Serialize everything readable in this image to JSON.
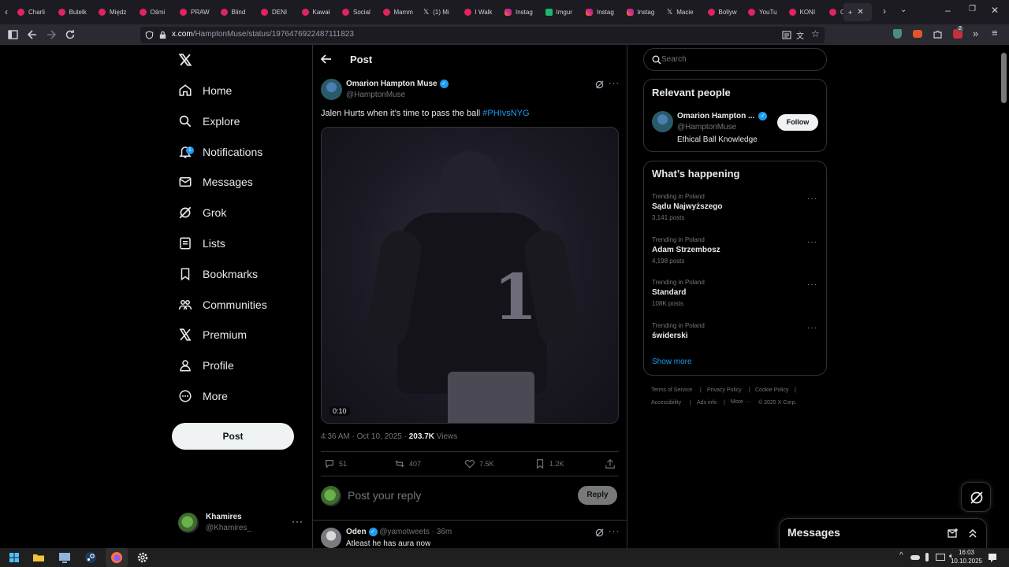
{
  "browser": {
    "tabs": [
      {
        "label": "Charli",
        "icon": "yt"
      },
      {
        "label": "Butelk",
        "icon": "yt"
      },
      {
        "label": "Międz",
        "icon": "yt"
      },
      {
        "label": "Ośmi",
        "icon": "yt"
      },
      {
        "label": "PRAW",
        "icon": "yt"
      },
      {
        "label": "Blind",
        "icon": "yt"
      },
      {
        "label": "DENI",
        "icon": "yt"
      },
      {
        "label": "Kawał",
        "icon": "yt"
      },
      {
        "label": "Social",
        "icon": "yt"
      },
      {
        "label": "Mamm",
        "icon": "yt"
      },
      {
        "label": "(1) Mi",
        "icon": "x"
      },
      {
        "label": "I Walk",
        "icon": "yt"
      },
      {
        "label": "Instag",
        "icon": "ig"
      },
      {
        "label": "Imgur",
        "icon": "im"
      },
      {
        "label": "Instag",
        "icon": "ig"
      },
      {
        "label": "Instag",
        "icon": "ig"
      },
      {
        "label": "Macie",
        "icon": "x"
      },
      {
        "label": "Bollyw",
        "icon": "yt"
      },
      {
        "label": "YouTu",
        "icon": "yt"
      },
      {
        "label": "KONI",
        "icon": "yt"
      },
      {
        "label": "Odeb",
        "icon": "yt"
      }
    ],
    "url_host": "x.com",
    "url_path": "/HamptonMuse/status/1976476922487111823",
    "notif_count": "2"
  },
  "nav": {
    "items": [
      {
        "label": "Home",
        "icon": "home-icon"
      },
      {
        "label": "Explore",
        "icon": "search-icon"
      },
      {
        "label": "Notifications",
        "icon": "bell-icon"
      },
      {
        "label": "Messages",
        "icon": "mail-icon"
      },
      {
        "label": "Grok",
        "icon": "grok-icon"
      },
      {
        "label": "Lists",
        "icon": "list-icon"
      },
      {
        "label": "Bookmarks",
        "icon": "bookmark-icon"
      },
      {
        "label": "Communities",
        "icon": "communities-icon"
      },
      {
        "label": "Premium",
        "icon": "x-logo-icon"
      },
      {
        "label": "Profile",
        "icon": "person-icon"
      },
      {
        "label": "More",
        "icon": "more-circle-icon"
      }
    ],
    "notification_badge": "1",
    "post_button": "Post",
    "account": {
      "name": "Khamires",
      "handle": "@Khamires_"
    }
  },
  "post": {
    "header_title": "Post",
    "author_name": "Omarion Hampton Muse",
    "author_handle": "@HamptonMuse",
    "text": "Jalen Hurts when it’s time to pass the ball",
    "hashtag": "#PHIvsNYG",
    "video_duration": "0:10",
    "jersey_number": "1",
    "timestamp": "4:36 AM · Oct 10, 2025 ·",
    "views_count": "203.7K",
    "views_label": "Views",
    "stats": {
      "replies": "51",
      "reposts": "407",
      "likes": "7.5K",
      "bookmarks": "1.2K"
    },
    "reply_placeholder": "Post your reply",
    "reply_button": "Reply"
  },
  "reply": {
    "author_name": "Oden",
    "author_handle": "@yamotweets",
    "age": "· 36m",
    "text": "Atleast he has aura now"
  },
  "sidebar": {
    "search_placeholder": "Search",
    "relevant_title": "Relevant people",
    "person_name": "Omarion Hampton ...",
    "person_handle": "@HamptonMuse",
    "person_bio": "Ethical Ball Knowledge",
    "follow_label": "Follow",
    "happening_title": "What’s happening",
    "trends": [
      {
        "context": "Trending in Poland",
        "name": "Sądu Najwyższego",
        "count": "3,141 posts"
      },
      {
        "context": "Trending in Poland",
        "name": "Adam Strzembosz",
        "count": "4,198 posts"
      },
      {
        "context": "Trending in Poland",
        "name": "Standard",
        "count": "108K posts"
      },
      {
        "context": "Trending in Poland",
        "name": "świderski",
        "count": ""
      }
    ],
    "show_more": "Show more",
    "footer": {
      "terms": "Terms of Service",
      "privacy": "Privacy Policy",
      "cookie": "Cookie Policy",
      "accessibility": "Accessibility",
      "ads": "Ads info",
      "more": "More ···",
      "copyright": "© 2025 X Corp."
    }
  },
  "messages_drawer": {
    "title": "Messages"
  },
  "taskbar": {
    "time": "16:03",
    "date": "10.10.2025"
  },
  "colors": {
    "accent": "#1d9bf0",
    "background": "#000000",
    "border": "#2f3336",
    "muted": "#71767b"
  }
}
